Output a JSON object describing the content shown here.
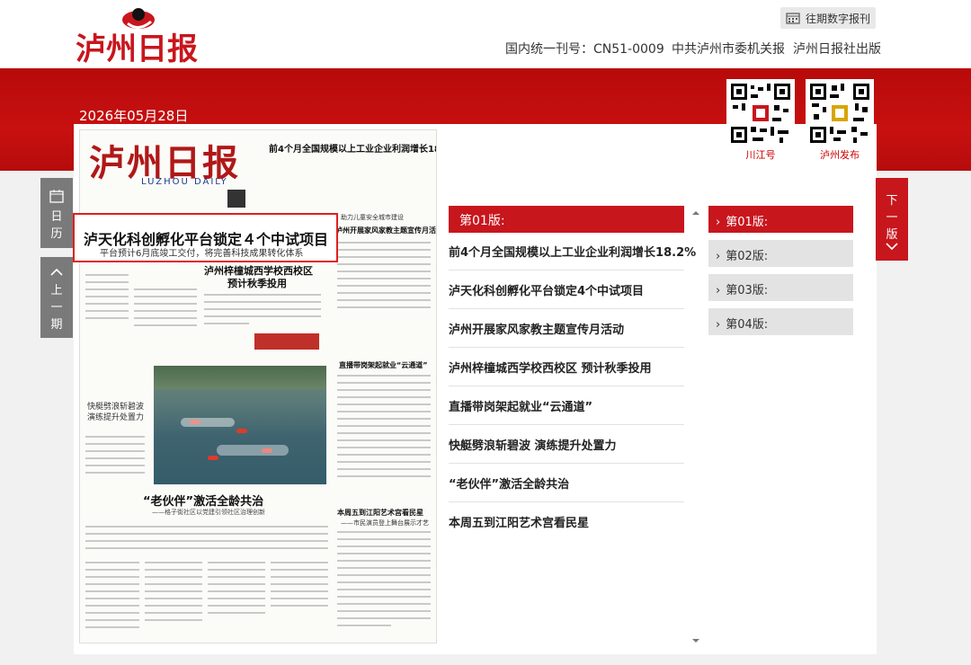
{
  "header": {
    "logo_text": "泸州日报",
    "archive_label": "往期数字报刊",
    "issn": "国内统一刊号：CN51-0009",
    "organ": "中共泸州市委机关报",
    "publisher": "泸州日报社出版"
  },
  "date": "2026年05月28日",
  "qr_codes": [
    {
      "label": "川江号"
    },
    {
      "label": "泸州发布"
    }
  ],
  "nav": {
    "calendar_label_1": "日",
    "calendar_label_2": "历",
    "prev_label_1": "上",
    "prev_label_2": "一",
    "prev_label_3": "期",
    "next_label_1": "下",
    "next_label_2": "一",
    "next_label_3": "版"
  },
  "paper": {
    "masthead": "泸州日报",
    "masthead_en": "LUZHOU DAILY",
    "headline_top": "前4个月全国规模以上工业企业利润增长18.2%",
    "sidebar_title": "助力儿童安全城市建设",
    "sidebar_sub": "泸州开展家风家教主题宣传月活动",
    "article_title_2": "泸州梓橦城西学校西校区",
    "article_title_2b": "预计秋季投用",
    "mid_title": "直播带岗架起就业“云通道”",
    "boat_title": "快艇劈浪斩碧波",
    "boat_title_b": "演练提升处置力",
    "partner_title": "“老伙伴”激活全龄共治",
    "partner_sub": "——格子街社区以党建引领社区治理创新",
    "jiangyang_title": "本周五到江阳艺术宫看民星",
    "jiangyang_sub": "——市民演员登上舞台展示才艺"
  },
  "highlight": {
    "title": "泸天化科创孵化平台锁定４个中试项目",
    "subtitle": "平台预计6月底竣工交付，将完善科技成果转化体系"
  },
  "article_list": {
    "header": "第01版:",
    "items": [
      "前4个月全国规模以上工业企业利润增长18.2%",
      "泸天化科创孵化平台锁定4个中试项目",
      "泸州开展家风家教主题宣传月活动",
      "泸州梓橦城西学校西校区 预计秋季投用",
      "直播带岗架起就业“云通道”",
      "快艇劈浪斩碧波 演练提升处置力",
      "“老伙伴”激活全龄共治",
      "本周五到江阳艺术宫看民星"
    ]
  },
  "versions": [
    {
      "label": "第01版:",
      "active": true
    },
    {
      "label": "第02版:",
      "active": false
    },
    {
      "label": "第03版:",
      "active": false
    },
    {
      "label": "第04版:",
      "active": false
    }
  ],
  "colors": {
    "brand_red": "#c8161d",
    "band_red": "#be0d0d"
  }
}
